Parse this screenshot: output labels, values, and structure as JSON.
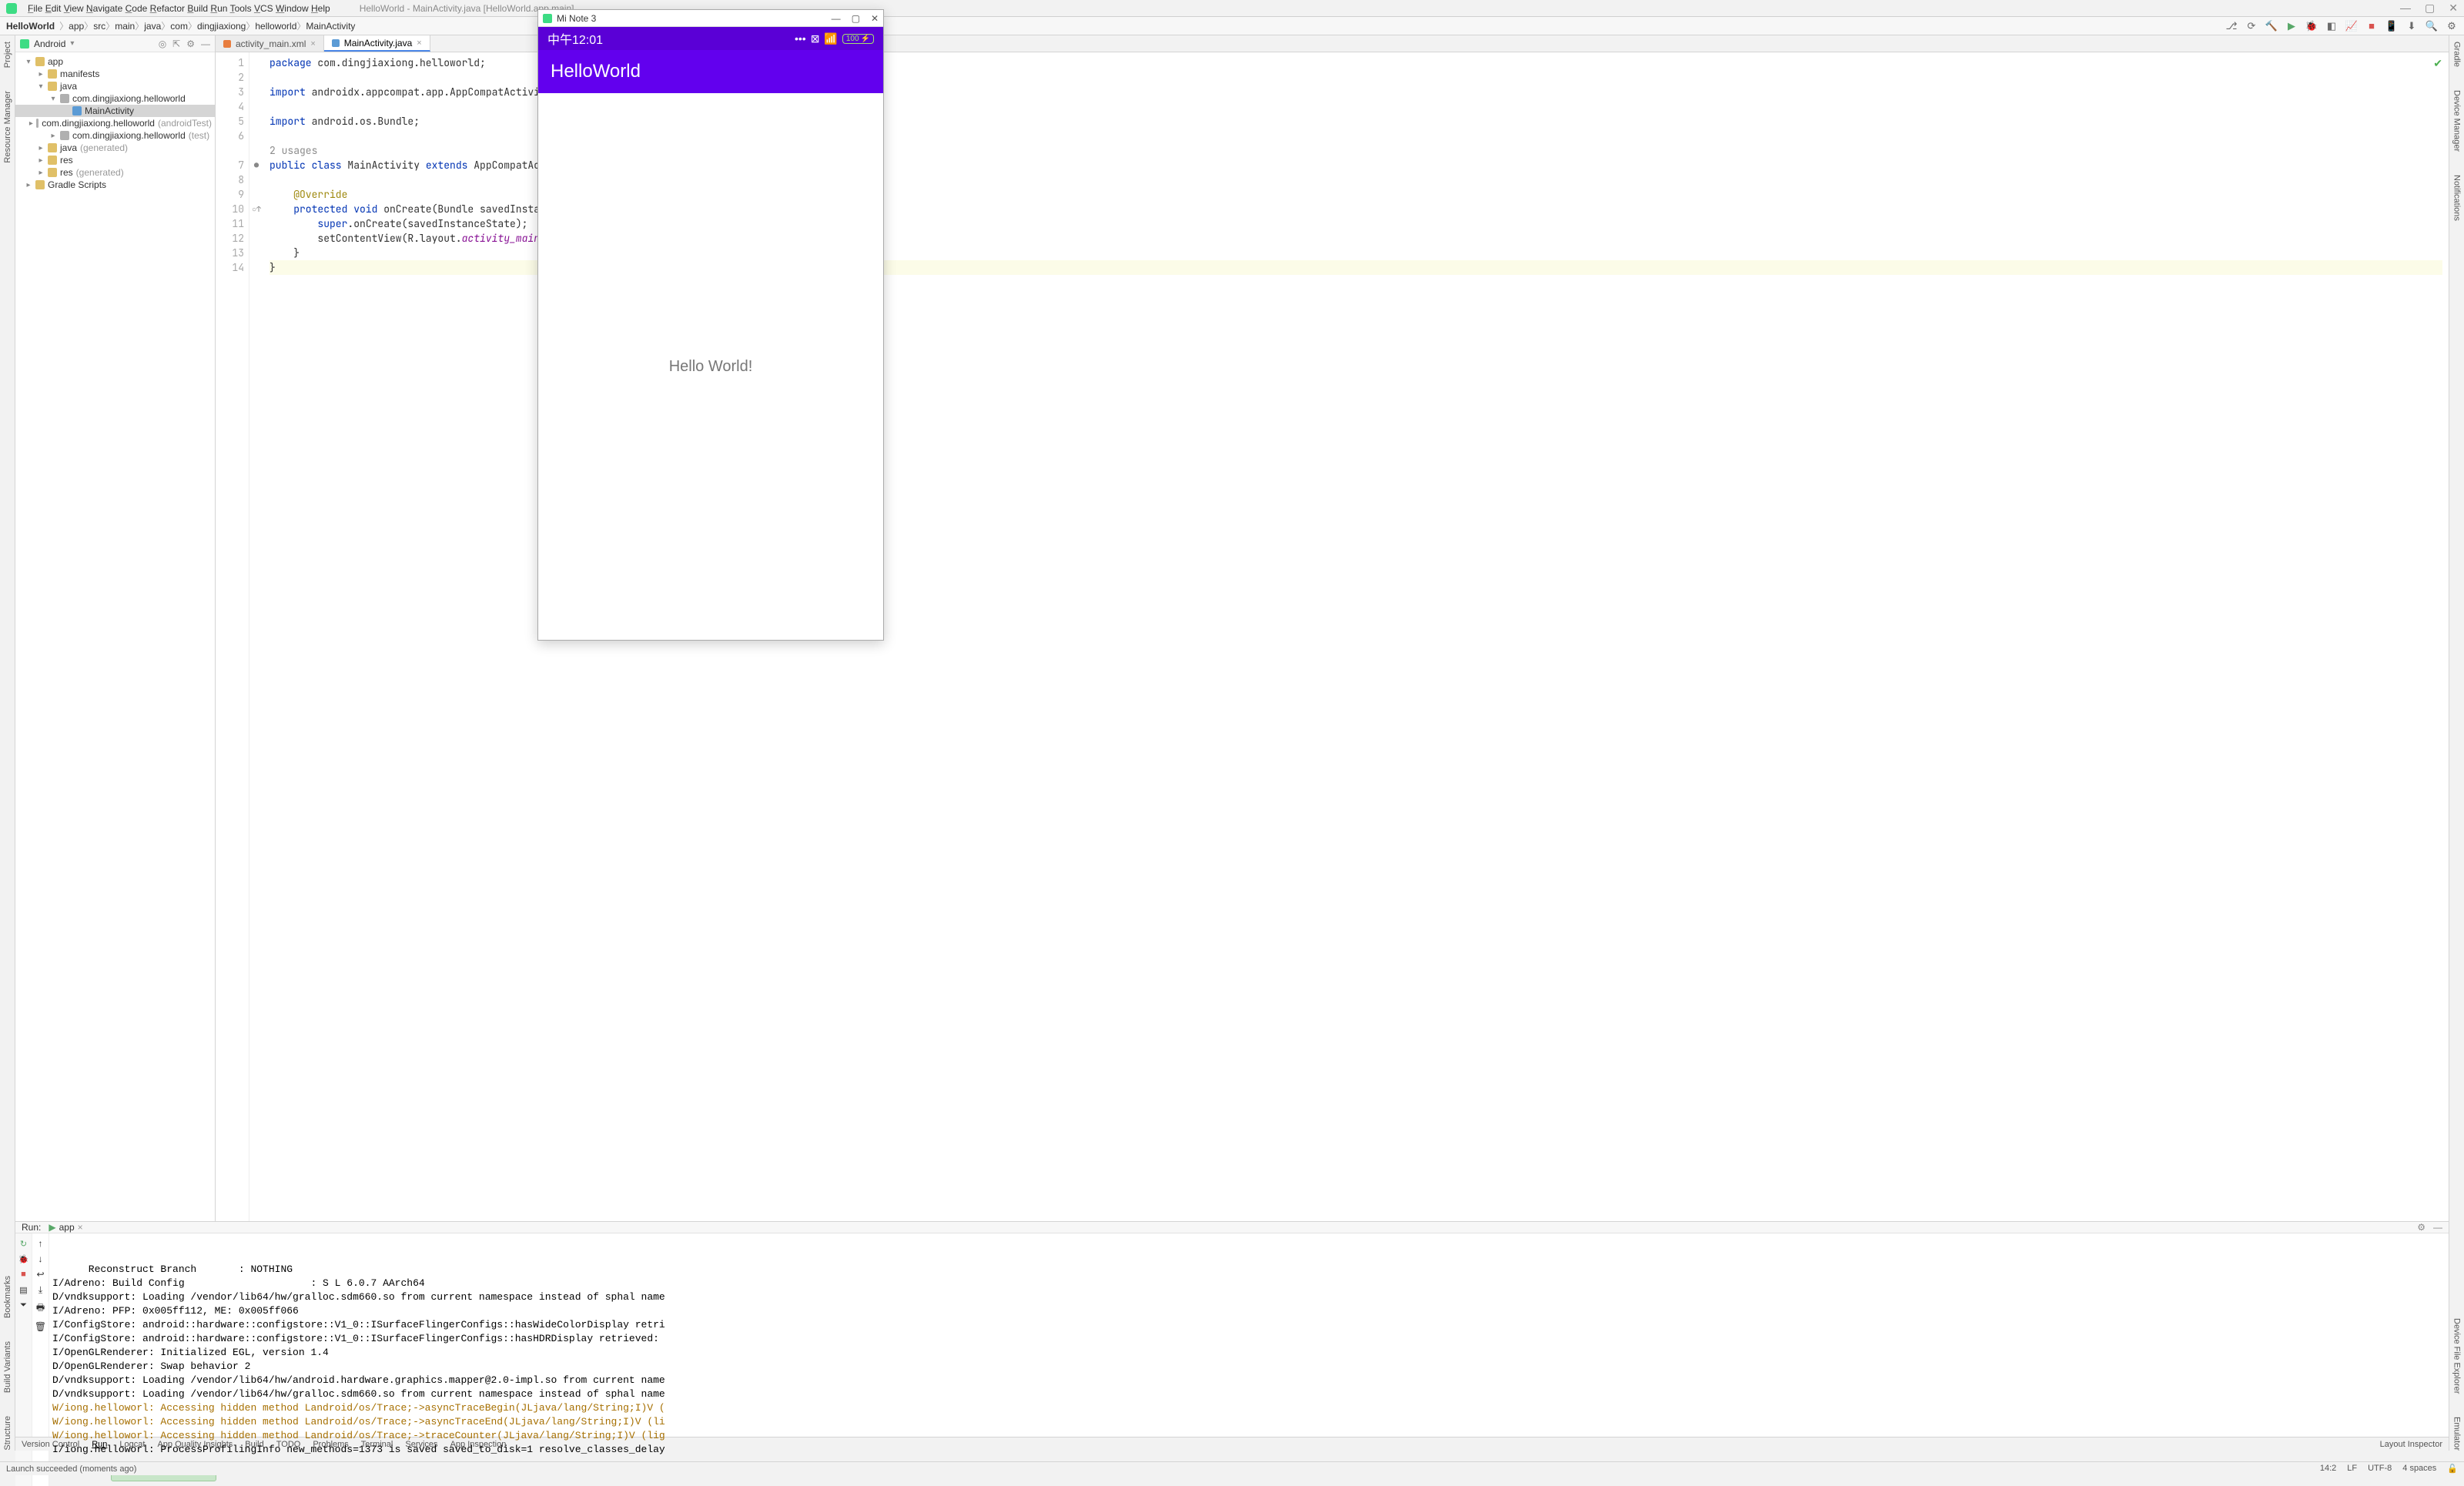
{
  "menubar": {
    "items": [
      "File",
      "Edit",
      "View",
      "Navigate",
      "Code",
      "Refactor",
      "Build",
      "Run",
      "Tools",
      "VCS",
      "Window",
      "Help"
    ],
    "title_path": "HelloWorld - MainActivity.java [HelloWorld.app.main]"
  },
  "breadcrumb": {
    "project": "HelloWorld",
    "crumbs": [
      "app",
      "src",
      "main",
      "java",
      "com",
      "dingjiaxiong",
      "helloworld",
      "MainActivity"
    ]
  },
  "project_panel": {
    "header": "Android",
    "tree": [
      {
        "depth": 0,
        "caret": "▾",
        "icon": "folder",
        "label": "app"
      },
      {
        "depth": 1,
        "caret": "▸",
        "icon": "folder",
        "label": "manifests"
      },
      {
        "depth": 1,
        "caret": "▾",
        "icon": "folder",
        "label": "java"
      },
      {
        "depth": 2,
        "caret": "▾",
        "icon": "pkg",
        "label": "com.dingjiaxiong.helloworld"
      },
      {
        "depth": 3,
        "caret": "",
        "icon": "file",
        "label": "MainActivity",
        "selected": true
      },
      {
        "depth": 2,
        "caret": "▸",
        "icon": "pkg",
        "label": "com.dingjiaxiong.helloworld",
        "suffix": "(androidTest)"
      },
      {
        "depth": 2,
        "caret": "▸",
        "icon": "pkg",
        "label": "com.dingjiaxiong.helloworld",
        "suffix": "(test)"
      },
      {
        "depth": 1,
        "caret": "▸",
        "icon": "folder",
        "label": "java",
        "suffix": "(generated)"
      },
      {
        "depth": 1,
        "caret": "▸",
        "icon": "folder",
        "label": "res"
      },
      {
        "depth": 1,
        "caret": "▸",
        "icon": "folder",
        "label": "res",
        "suffix": "(generated)"
      },
      {
        "depth": 0,
        "caret": "▸",
        "icon": "folder",
        "label": "Gradle Scripts"
      }
    ]
  },
  "editor": {
    "tabs": [
      {
        "label": "activity_main.xml",
        "active": false
      },
      {
        "label": "MainActivity.java",
        "active": true
      }
    ],
    "lines_start": 1,
    "usages_hint": "2 usages",
    "code_rows": [
      {
        "n": 1,
        "html": "<span class='kw'>package</span> com.dingjiaxiong.helloworld;"
      },
      {
        "n": 2,
        "html": ""
      },
      {
        "n": 3,
        "html": "<span class='kw'>import</span> androidx.appcompat.app.AppCompatActivity;"
      },
      {
        "n": 4,
        "html": ""
      },
      {
        "n": 5,
        "html": "<span class='kw'>import</span> android.os.Bundle;"
      },
      {
        "n": 6,
        "html": ""
      },
      {
        "n": "",
        "html": "<span class='cmt'>2 usages</span>",
        "noNum": true
      },
      {
        "n": 7,
        "html": "<span class='kw'>public class</span> MainActivity <span class='kw'>extends</span> AppCompatActivity {",
        "mark": "●"
      },
      {
        "n": 8,
        "html": ""
      },
      {
        "n": 9,
        "html": "    <span class='ann'>@Override</span>"
      },
      {
        "n": 10,
        "html": "    <span class='kw'>protected void</span> onCreate(Bundle savedInstanceState) {",
        "mark": "○↑"
      },
      {
        "n": 11,
        "html": "        <span class='kw'>super</span>.onCreate(savedInstanceState);"
      },
      {
        "n": 12,
        "html": "        setContentView(R.layout.<span class='ital'>activity_main</span>);"
      },
      {
        "n": 13,
        "html": "    }"
      },
      {
        "n": 14,
        "html": "}",
        "hl": true
      }
    ]
  },
  "run": {
    "label": "Run:",
    "tab": "app",
    "console": [
      {
        "cls": "log",
        "text": "      Reconstruct Branch       : NOTHING"
      },
      {
        "cls": "log",
        "text": "I/Adreno: Build Config                     : S L 6.0.7 AArch64"
      },
      {
        "cls": "log",
        "text": "D/vndksupport: Loading /vendor/lib64/hw/gralloc.sdm660.so from current namespace instead of sphal name"
      },
      {
        "cls": "log",
        "text": "I/Adreno: PFP: 0x005ff112, ME: 0x005ff066"
      },
      {
        "cls": "log",
        "text": "I/ConfigStore: android::hardware::configstore::V1_0::ISurfaceFlingerConfigs::hasWideColorDisplay retri"
      },
      {
        "cls": "log",
        "text": "I/ConfigStore: android::hardware::configstore::V1_0::ISurfaceFlingerConfigs::hasHDRDisplay retrieved:"
      },
      {
        "cls": "log",
        "text": "I/OpenGLRenderer: Initialized EGL, version 1.4"
      },
      {
        "cls": "log",
        "text": "D/OpenGLRenderer: Swap behavior 2"
      },
      {
        "cls": "log",
        "text": "D/vndksupport: Loading /vendor/lib64/hw/android.hardware.graphics.mapper@2.0-impl.so from current name"
      },
      {
        "cls": "log",
        "text": "D/vndksupport: Loading /vendor/lib64/hw/gralloc.sdm660.so from current namespace instead of sphal name"
      },
      {
        "cls": "warn",
        "text": "W/iong.helloworl: Accessing hidden method Landroid/os/Trace;->asyncTraceBegin(JLjava/lang/String;I)V ("
      },
      {
        "cls": "warn",
        "text": "W/iong.helloworl: Accessing hidden method Landroid/os/Trace;->asyncTraceEnd(JLjava/lang/String;I)V (li"
      },
      {
        "cls": "warn",
        "text": "W/iong.helloworl: Accessing hidden method Landroid/os/Trace;->traceCounter(JLjava/lang/String;I)V (lig"
      },
      {
        "cls": "log",
        "text": "I/iong.helloworl: ProcessProfilingInfo new_methods=1373 is saved saved_to_disk=1 resolve_classes_delay"
      }
    ],
    "toast": "Launch succeeded"
  },
  "bottom_tabs": [
    "Version Control",
    "Run",
    "Logcat",
    "App Quality Insights",
    "Build",
    "TODO",
    "Problems",
    "Terminal",
    "Services",
    "App Inspection"
  ],
  "bottom_right": "Layout Inspector",
  "status": {
    "left": "Launch succeeded (moments ago)",
    "right": [
      "14:2",
      "LF",
      "UTF-8",
      "4 spaces"
    ]
  },
  "emulator": {
    "title": "Mi Note 3",
    "clock": "中午12:01",
    "battery": "100",
    "app_title": "HelloWorld",
    "body_text": "Hello World!"
  },
  "left_gutter": [
    "Project",
    "Resource Manager"
  ],
  "right_gutter": [
    "Gradle",
    "Device Manager",
    "Notifications",
    "Device File Explorer",
    "Emulator"
  ],
  "left_gutter2": [
    "Bookmarks",
    "Build Variants",
    "Structure"
  ]
}
